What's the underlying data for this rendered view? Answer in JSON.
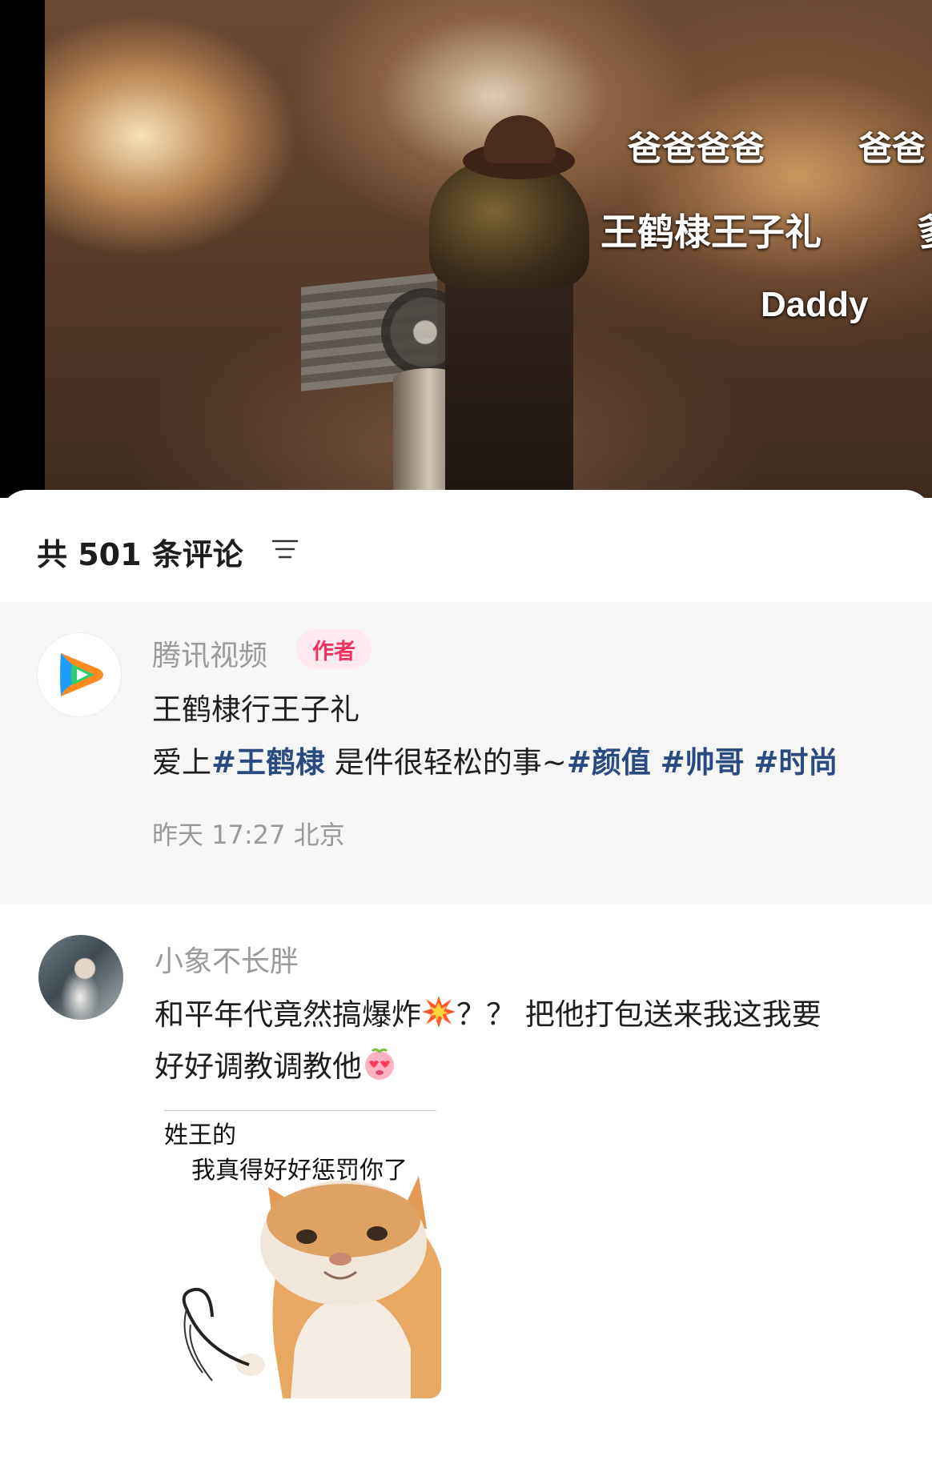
{
  "video": {
    "lyrics": [
      "爸爸爸爸",
      "爸爸",
      "王鹤棣王子礼",
      "爹",
      "Daddy"
    ]
  },
  "comments": {
    "count_label": "共 501 条评论",
    "filter_icon": "filter-icon",
    "pinned": {
      "avatar_icon": "tencent-video-logo",
      "username": "腾讯视频",
      "badge": "作者",
      "line1": "王鹤棣行王子礼",
      "line2_prefix": "爱上",
      "line2_tag1": "#王鹤棣",
      "line2_mid": " 是件很轻松的事~",
      "line2_tag2": "#颜值",
      "line2_tag3": "#帅哥",
      "line2_tag4": "#时尚",
      "time": "昨天 17:27",
      "location": "北京"
    },
    "reply": {
      "username": "小象不长胖",
      "line1_a": "和平年代竟然搞爆炸",
      "line1_b": "？？ 把他打包送来我这我要",
      "line2": "好好调教调教他",
      "emoji1": "collision-emoji",
      "emoji2": "heart-eyes-emoji",
      "meme": {
        "text1": "姓王的",
        "text2": "我真得好好惩罚你了"
      }
    }
  },
  "colors": {
    "hashtag": "#2b4a82",
    "badge_text": "#f0325f",
    "badge_bg": "#fde9ee",
    "meta": "#9a9a9a",
    "pinned_bg": "#f6f6f6"
  }
}
